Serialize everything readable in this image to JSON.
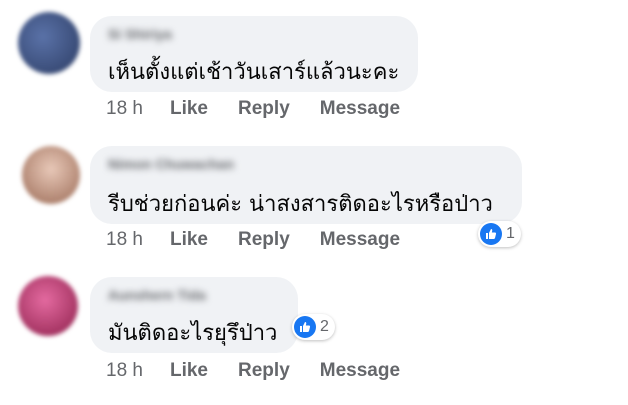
{
  "comments": [
    {
      "author": "Si Shiriya",
      "text": "เห็นตั้งแต่เช้าวันเสาร์แล้วนะคะ",
      "time": "18 h",
      "like_label": "Like",
      "reply_label": "Reply",
      "message_label": "Message",
      "avatar_color": "#3b4f7a",
      "reaction_count": null
    },
    {
      "author": "Nimon Chuwachan",
      "text": "รีบช่วยก่อนค่ะ น่าสงสารติดอะไรหรือป่าว",
      "time": "18 h",
      "like_label": "Like",
      "reply_label": "Reply",
      "message_label": "Message",
      "avatar_color": "#c9a08e",
      "reaction_count": "1"
    },
    {
      "author": "Aunshern Tida",
      "text": "มันติดอะไรยุรึป่าว",
      "time": "18 h",
      "like_label": "Like",
      "reply_label": "Reply",
      "message_label": "Message",
      "avatar_color": "#b5336b",
      "reaction_count": "2"
    }
  ],
  "colors": {
    "bubble": "#f0f2f5",
    "like_blue": "#1877f2",
    "meta_text": "#65676b"
  },
  "icons": {
    "reaction": "like-icon"
  }
}
